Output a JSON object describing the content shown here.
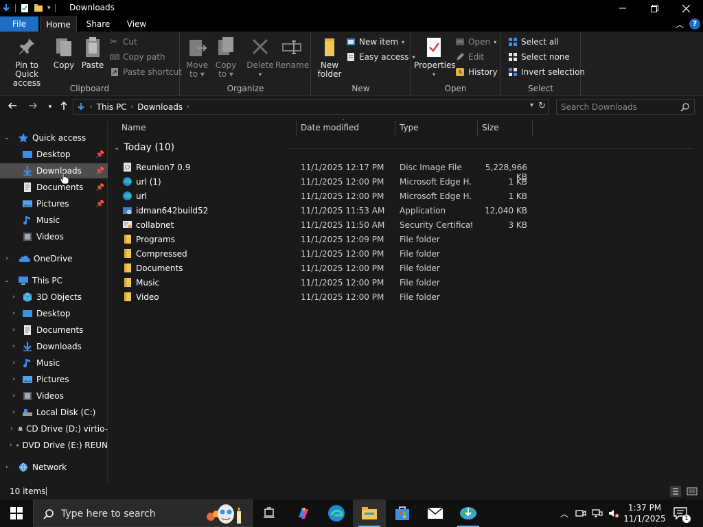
{
  "window": {
    "title": "Downloads"
  },
  "ribbon_tabs": {
    "file": "File",
    "home": "Home",
    "share": "Share",
    "view": "View"
  },
  "ribbon": {
    "clipboard": {
      "label": "Clipboard",
      "pin": "Pin to Quick\naccess",
      "copy": "Copy",
      "paste": "Paste",
      "cut": "Cut",
      "copy_path": "Copy path",
      "paste_shortcut": "Paste shortcut"
    },
    "organize": {
      "label": "Organize",
      "move_to": "Move\nto",
      "copy_to": "Copy\nto",
      "delete": "Delete",
      "rename": "Rename"
    },
    "new": {
      "label": "New",
      "new_folder": "New\nfolder",
      "new_item": "New item",
      "easy_access": "Easy access"
    },
    "open": {
      "label": "Open",
      "properties": "Properties",
      "open": "Open",
      "edit": "Edit",
      "history": "History"
    },
    "select": {
      "label": "Select",
      "select_all": "Select all",
      "select_none": "Select none",
      "invert": "Invert selection"
    }
  },
  "address": {
    "crumbs": [
      "This PC",
      "Downloads"
    ],
    "search_placeholder": "Search Downloads"
  },
  "nav": {
    "quick_access": "Quick access",
    "quick_items": [
      {
        "label": "Desktop"
      },
      {
        "label": "Downloads"
      },
      {
        "label": "Documents"
      },
      {
        "label": "Pictures"
      },
      {
        "label": "Music"
      },
      {
        "label": "Videos"
      }
    ],
    "onedrive": "OneDrive",
    "this_pc": "This PC",
    "pc_items": [
      {
        "label": "3D Objects"
      },
      {
        "label": "Desktop"
      },
      {
        "label": "Documents"
      },
      {
        "label": "Downloads"
      },
      {
        "label": "Music"
      },
      {
        "label": "Pictures"
      },
      {
        "label": "Videos"
      },
      {
        "label": "Local Disk (C:)"
      },
      {
        "label": "CD Drive (D:) virtio-"
      },
      {
        "label": "DVD Drive (E:) REUN"
      }
    ],
    "network": "Network"
  },
  "columns": {
    "name": "Name",
    "date": "Date modified",
    "type": "Type",
    "size": "Size"
  },
  "group": {
    "label": "Today (10)"
  },
  "files": [
    {
      "name": "Reunion7 0.9",
      "date": "11/1/2025 12:17 PM",
      "type": "Disc Image File",
      "size": "5,228,966 KB",
      "icon": "disc-image-icon"
    },
    {
      "name": "url (1)",
      "date": "11/1/2025 12:00 PM",
      "type": "Microsoft Edge H...",
      "size": "1 KB",
      "icon": "edge-icon"
    },
    {
      "name": "url",
      "date": "11/1/2025 12:00 PM",
      "type": "Microsoft Edge H...",
      "size": "1 KB",
      "icon": "edge-icon"
    },
    {
      "name": "idman642build52",
      "date": "11/1/2025 11:53 AM",
      "type": "Application",
      "size": "12,040 KB",
      "icon": "installer-icon"
    },
    {
      "name": "collabnet",
      "date": "11/1/2025 11:50 AM",
      "type": "Security Certificate",
      "size": "3 KB",
      "icon": "certificate-icon"
    },
    {
      "name": "Programs",
      "date": "11/1/2025 12:09 PM",
      "type": "File folder",
      "size": "",
      "icon": "folder-icon"
    },
    {
      "name": "Compressed",
      "date": "11/1/2025 12:00 PM",
      "type": "File folder",
      "size": "",
      "icon": "folder-icon"
    },
    {
      "name": "Documents",
      "date": "11/1/2025 12:00 PM",
      "type": "File folder",
      "size": "",
      "icon": "folder-icon"
    },
    {
      "name": "Music",
      "date": "11/1/2025 12:00 PM",
      "type": "File folder",
      "size": "",
      "icon": "folder-icon"
    },
    {
      "name": "Video",
      "date": "11/1/2025 12:00 PM",
      "type": "File folder",
      "size": "",
      "icon": "folder-icon"
    }
  ],
  "status": {
    "items": "10 items"
  },
  "taskbar": {
    "search_text": "Type here to search",
    "clock_time": "1:37 PM",
    "clock_date": "11/1/2025",
    "notification_count": "1"
  },
  "colors": {
    "accent": "#1a6fc4",
    "folder": "#f0c656",
    "selected": "#4d4d4d",
    "background": "#191919"
  }
}
